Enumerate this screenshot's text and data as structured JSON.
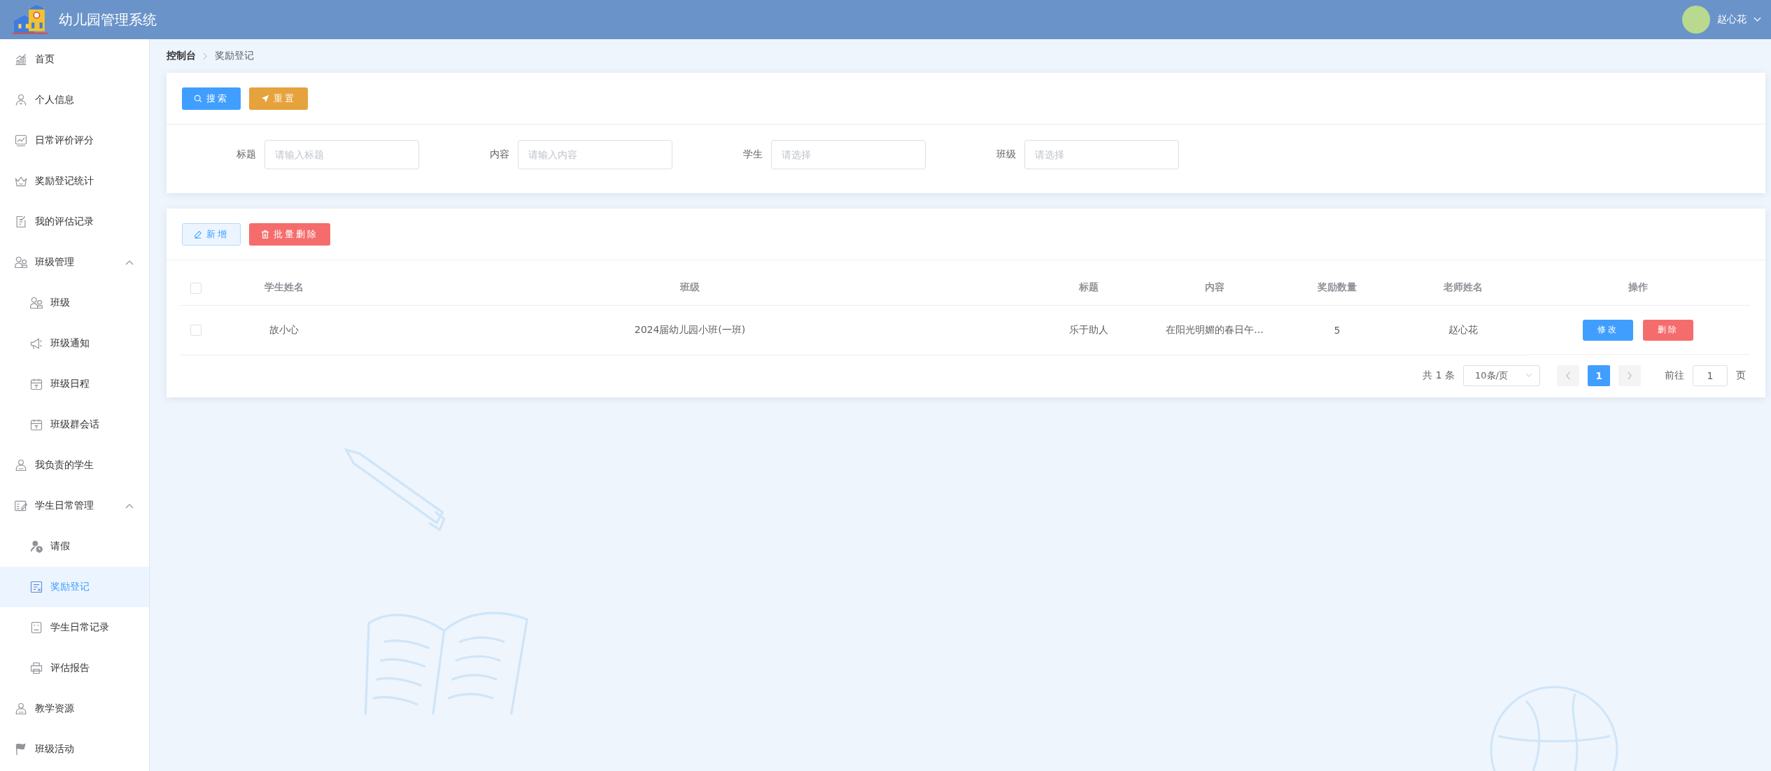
{
  "header": {
    "title": "幼儿园管理系统",
    "user": "赵心花"
  },
  "sidebar": {
    "items": [
      {
        "label": "首页",
        "selected": false
      },
      {
        "label": "个人信息",
        "selected": false
      },
      {
        "label": "日常评价评分",
        "selected": false
      },
      {
        "label": "奖励登记统计",
        "selected": false
      },
      {
        "label": "我的评估记录",
        "selected": false
      },
      {
        "label": "班级管理",
        "selected": false,
        "expanded": true,
        "children": [
          {
            "label": "班级",
            "selected": false
          },
          {
            "label": "班级通知",
            "selected": false
          },
          {
            "label": "班级日程",
            "selected": false
          },
          {
            "label": "班级群会话",
            "selected": false
          }
        ]
      },
      {
        "label": "我负责的学生",
        "selected": false
      },
      {
        "label": "学生日常管理",
        "selected": false,
        "expanded": true,
        "children": [
          {
            "label": "请假",
            "selected": false
          },
          {
            "label": "奖励登记",
            "selected": true
          },
          {
            "label": "学生日常记录",
            "selected": false
          },
          {
            "label": "评估报告",
            "selected": false
          }
        ]
      },
      {
        "label": "教学资源",
        "selected": false
      },
      {
        "label": "班级活动",
        "selected": false
      }
    ]
  },
  "breadcrumb": [
    "控制台",
    "奖励登记"
  ],
  "search_panel": {
    "buttons": [
      {
        "kind": "search",
        "label": "搜索"
      },
      {
        "kind": "reset",
        "label": "重置"
      }
    ],
    "fields": [
      {
        "label": "标题",
        "placeholder": "请输入标题"
      },
      {
        "label": "内容",
        "placeholder": "请输入内容"
      },
      {
        "label": "学生",
        "placeholder": "请选择"
      },
      {
        "label": "班级",
        "placeholder": "请选择"
      }
    ]
  },
  "table_panel": {
    "buttons": [
      {
        "kind": "add",
        "label": "新增"
      },
      {
        "kind": "batch_delete",
        "label": "批量删除"
      }
    ],
    "table": {
      "all_checked": false,
      "columns": [
        "学生姓名",
        "班级",
        "标题",
        "内容",
        "奖励数量",
        "老师姓名",
        "操作"
      ],
      "rows": [
        {
          "checked": false,
          "cells": [
            "故小心",
            "2024届幼儿园小班(一班)",
            "乐于助人",
            "在阳光明媚的春日午...",
            "5",
            "赵心花"
          ],
          "actions": [
            {
              "kind": "edit",
              "label": "修改"
            },
            {
              "kind": "delete",
              "label": "删除"
            }
          ]
        }
      ]
    },
    "pagination": {
      "total": "共 1 条",
      "page_size": "10条/页",
      "pages": [
        {
          "label": "1",
          "selected": true
        }
      ],
      "goto_label": "前往",
      "goto_value": "1",
      "goto_suffix": "页"
    }
  }
}
